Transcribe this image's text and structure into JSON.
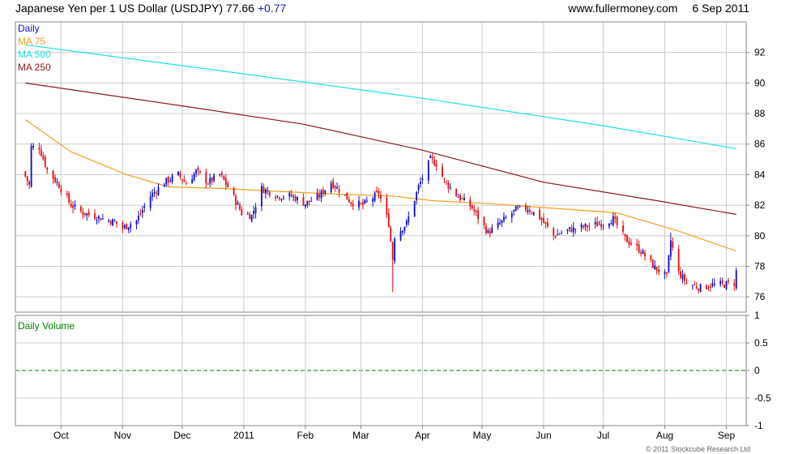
{
  "header": {
    "title": "Japanese Yen per 1 US Dollar (USDJPY)",
    "price": "77.66",
    "change": "+0.77",
    "site": "www.fullermoney.com",
    "date": "6 Sep 2011"
  },
  "copyright": "© 2011 Stockcube Research Ltd",
  "colors": {
    "up": "#1010c8",
    "down": "#e01010",
    "ma75": "#f0a020",
    "ma500": "#20e0e0",
    "ma250": "#8b1a1a",
    "volume_zero": "#008000",
    "grid": "#cccccc",
    "volume_label": "#008000"
  },
  "chart_data": [
    {
      "type": "candlestick",
      "title": "Japanese Yen per 1 US Dollar (USDJPY)",
      "legend": [
        "Daily",
        "MA 75",
        "MA 500",
        "MA 250"
      ],
      "legend_placement": "top-left",
      "y_axis_side": "right",
      "ylim": [
        75,
        94
      ],
      "yticks": [
        "76",
        "78",
        "80",
        "82",
        "84",
        "86",
        "88",
        "90",
        "92"
      ],
      "x_tick_labels": [
        "Oct",
        "Nov",
        "Dec",
        "2011",
        "Feb",
        "Mar",
        "Apr",
        "May",
        "Jun",
        "Jul",
        "Aug",
        "Sep"
      ],
      "grid": true,
      "close_path": [
        [
          "2010-09-13",
          83.9
        ],
        [
          "2010-09-15",
          83.3
        ],
        [
          "2010-09-16",
          85.8
        ],
        [
          "2010-09-20",
          85.8
        ],
        [
          "2010-09-24",
          84.3
        ],
        [
          "2010-09-30",
          83.3
        ],
        [
          "2010-10-06",
          82.0
        ],
        [
          "2010-10-12",
          81.5
        ],
        [
          "2010-10-20",
          81.2
        ],
        [
          "2010-10-28",
          80.9
        ],
        [
          "2010-11-01",
          80.5
        ],
        [
          "2010-11-08",
          81.0
        ],
        [
          "2010-11-15",
          82.6
        ],
        [
          "2010-11-22",
          83.5
        ],
        [
          "2010-11-29",
          84.0
        ],
        [
          "2010-12-03",
          83.4
        ],
        [
          "2010-12-08",
          84.2
        ],
        [
          "2010-12-14",
          83.5
        ],
        [
          "2010-12-20",
          84.0
        ],
        [
          "2010-12-24",
          83.2
        ],
        [
          "2010-12-31",
          81.5
        ],
        [
          "2011-01-05",
          81.3
        ],
        [
          "2011-01-10",
          83.1
        ],
        [
          "2011-01-18",
          82.6
        ],
        [
          "2011-01-25",
          82.6
        ],
        [
          "2011-02-01",
          82.1
        ],
        [
          "2011-02-08",
          82.6
        ],
        [
          "2011-02-14",
          83.5
        ],
        [
          "2011-02-18",
          83.0
        ],
        [
          "2011-02-24",
          82.2
        ],
        [
          "2011-03-02",
          82.0
        ],
        [
          "2011-03-10",
          82.8
        ],
        [
          "2011-03-15",
          80.8
        ],
        [
          "2011-03-17",
          78.5
        ],
        [
          "2011-03-18",
          80.0
        ],
        [
          "2011-03-24",
          80.8
        ],
        [
          "2011-03-30",
          83.2
        ],
        [
          "2011-04-05",
          85.0
        ],
        [
          "2011-04-08",
          84.7
        ],
        [
          "2011-04-12",
          83.6
        ],
        [
          "2011-04-18",
          82.7
        ],
        [
          "2011-04-26",
          81.8
        ],
        [
          "2011-05-04",
          80.2
        ],
        [
          "2011-05-10",
          80.8
        ],
        [
          "2011-05-18",
          81.7
        ],
        [
          "2011-05-24",
          81.8
        ],
        [
          "2011-05-30",
          81.2
        ],
        [
          "2011-06-06",
          80.0
        ],
        [
          "2011-06-14",
          80.4
        ],
        [
          "2011-06-22",
          80.6
        ],
        [
          "2011-06-30",
          80.8
        ],
        [
          "2011-07-06",
          81.1
        ],
        [
          "2011-07-12",
          79.8
        ],
        [
          "2011-07-20",
          79.0
        ],
        [
          "2011-07-27",
          77.9
        ],
        [
          "2011-08-02",
          77.3
        ],
        [
          "2011-08-04",
          79.7
        ],
        [
          "2011-08-08",
          77.6
        ],
        [
          "2011-08-12",
          76.9
        ],
        [
          "2011-08-19",
          76.6
        ],
        [
          "2011-08-26",
          76.8
        ],
        [
          "2011-08-30",
          76.8
        ],
        [
          "2011-09-05",
          76.9
        ],
        [
          "2011-09-06",
          77.66
        ]
      ],
      "spikes": [
        {
          "date": "2011-03-17",
          "low": 76.3
        },
        {
          "date": "2011-08-04",
          "high": 80.2
        }
      ],
      "series": [
        {
          "name": "MA 75",
          "color": "#f0a020",
          "x": [
            "2010-09-13",
            "2010-10-06",
            "2010-11-03",
            "2010-11-24",
            "2010-12-20",
            "2011-01-19",
            "2011-02-21",
            "2011-03-17",
            "2011-04-06",
            "2011-05-05",
            "2011-06-06",
            "2011-07-08",
            "2011-08-08",
            "2011-09-06"
          ],
          "values": [
            87.6,
            85.5,
            84.0,
            83.2,
            83.1,
            82.9,
            82.7,
            82.6,
            82.3,
            82.1,
            81.8,
            81.5,
            80.3,
            79.0
          ]
        },
        {
          "name": "MA 500",
          "color": "#20e0e0",
          "x": [
            "2010-09-13",
            "2011-01-01",
            "2011-04-01",
            "2011-07-01",
            "2011-09-06"
          ],
          "values": [
            92.5,
            90.6,
            89.0,
            87.2,
            85.7
          ]
        },
        {
          "name": "MA 250",
          "color": "#8b1a1a",
          "x": [
            "2010-09-13",
            "2010-12-01",
            "2011-01-31",
            "2011-04-01",
            "2011-06-01",
            "2011-07-28",
            "2011-09-06"
          ],
          "values": [
            90.0,
            88.5,
            87.3,
            85.6,
            83.5,
            82.3,
            81.4
          ]
        }
      ]
    },
    {
      "type": "bar",
      "title": "Daily Volume",
      "ylim": [
        -1,
        1
      ],
      "yticks": [
        "1",
        "0.5",
        "0",
        "-0.5",
        "-1"
      ],
      "x_tick_labels": [
        "Oct",
        "Nov",
        "Dec",
        "2011",
        "Feb",
        "Mar",
        "Apr",
        "May",
        "Jun",
        "Jul",
        "Aug",
        "Sep"
      ],
      "grid": true,
      "values": []
    }
  ]
}
